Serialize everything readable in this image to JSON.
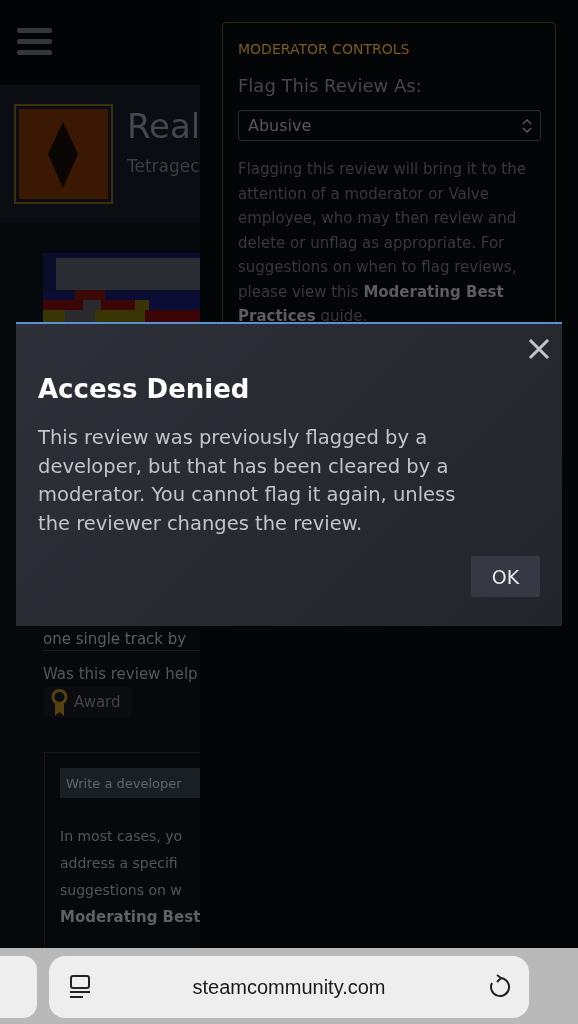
{
  "game": {
    "title": "Real",
    "subtitle": "Tetragec"
  },
  "review": {
    "text_fragment": "one single track by",
    "helpful_prompt": "Was this review help",
    "award_button": "Award"
  },
  "developer_response": {
    "button": "Write a developer",
    "text_lines": [
      "In most cases, yo",
      "address a specifi",
      "suggestions on w"
    ],
    "link": "Moderating Best"
  },
  "moderator_controls": {
    "heading": "MODERATOR CONTROLS",
    "flag_label": "Flag This Review As:",
    "flag_select": {
      "value": "Abusive"
    },
    "description": "Flagging this review will bring it to the attention of a moderator or Valve employee, who may then review and delete or unflag as appropriate. For suggestions on when to flag reviews, please view this **Moderating Best Practices** guide."
  },
  "dialog": {
    "title": "Access Denied",
    "message": "This review was previously flagged by a developer, but that has been cleared by a moderator. You cannot flag it again, unless the reviewer changes the review.",
    "ok_button": "OK"
  },
  "browser": {
    "url": "steamcommunity.com"
  }
}
